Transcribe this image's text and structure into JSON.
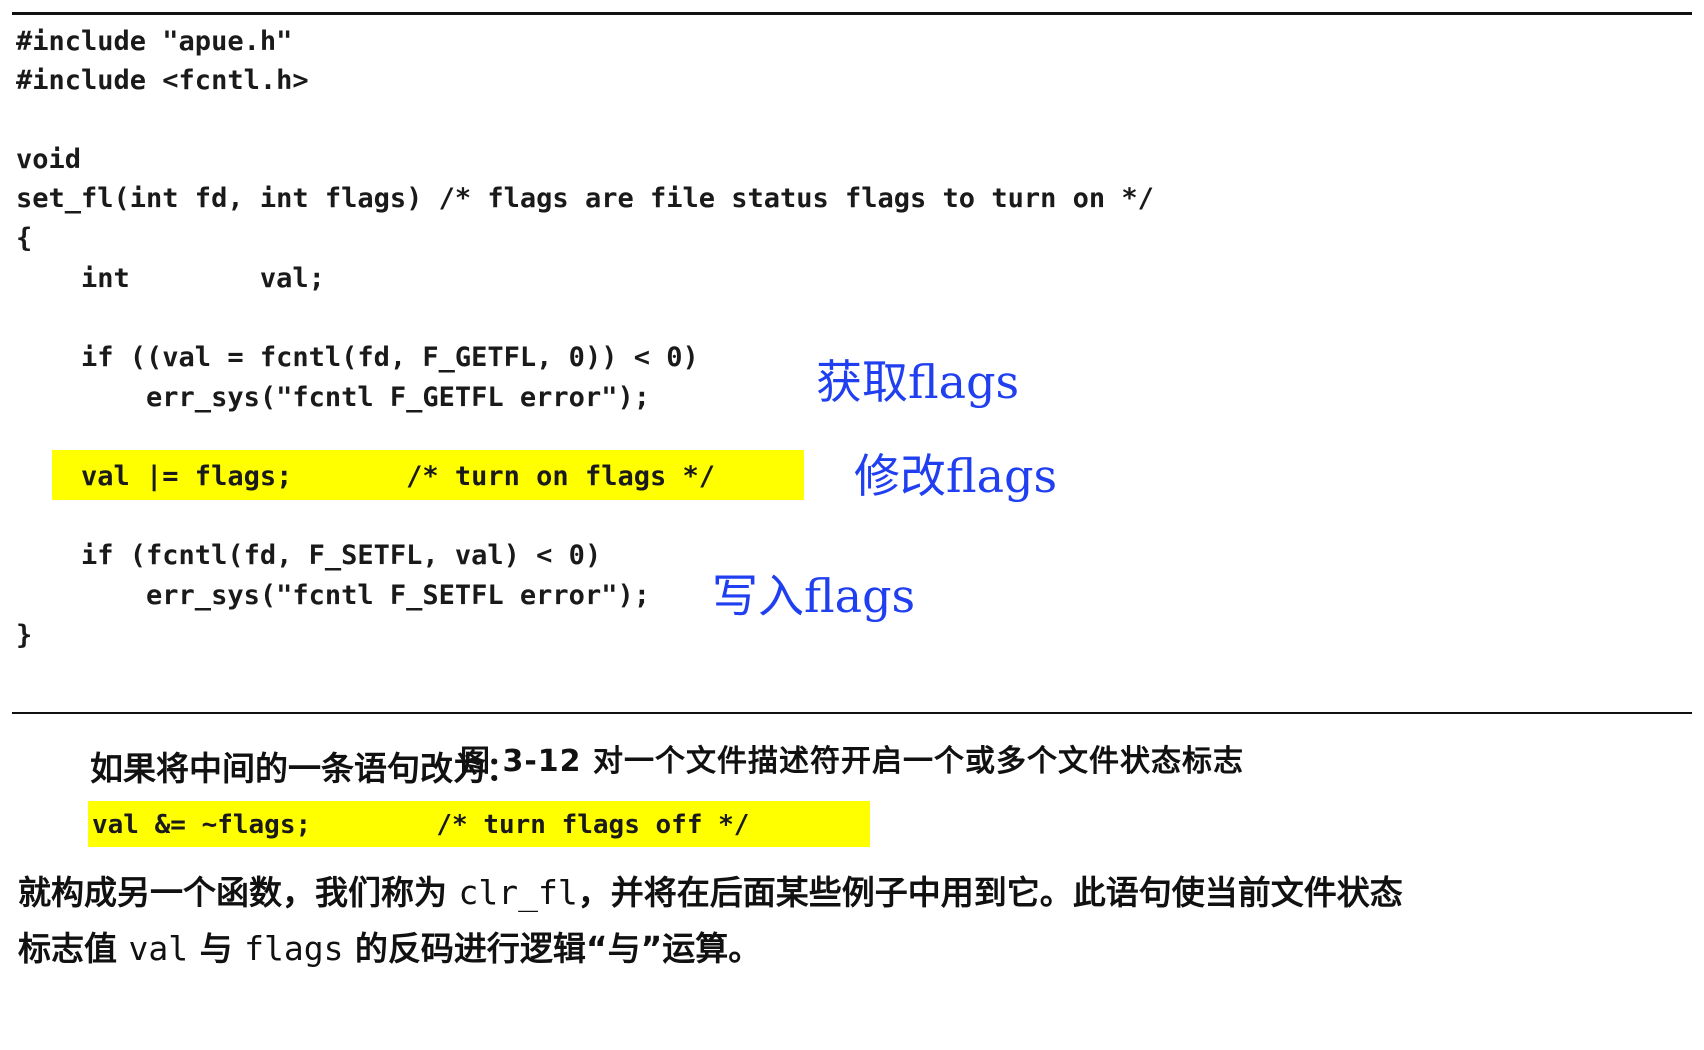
{
  "code": {
    "lines": [
      "#include \"apue.h\"",
      "#include <fcntl.h>",
      "",
      "void",
      "set_fl(int fd, int flags) /* flags are file status flags to turn on */",
      "{",
      "    int        val;",
      "",
      "    if ((val = fcntl(fd, F_GETFL, 0)) < 0)",
      "        err_sys(\"fcntl F_GETFL error\");",
      "",
      "    val |= flags;       /* turn on flags */",
      "",
      "    if (fcntl(fd, F_SETFL, val) < 0)",
      "        err_sys(\"fcntl F_SETFL error\");",
      "}"
    ]
  },
  "annotations": {
    "get_flags": "获取flags",
    "modify_flags": "修改flags",
    "write_flags": "写入flags"
  },
  "caption": "图 3-12   对一个文件描述符开启一个或多个文件状态标志",
  "paragraph": {
    "intro": "如果将中间的一条语句改为：",
    "alt_statement": "val &= ~flags;        /* turn flags off */",
    "body_line1_a": "就构成另一个函数，我们称为 ",
    "body_line1_code": "clr_fl",
    "body_line1_b": "，并将在后面某些例子中用到它。此语句使当前文件状态",
    "body_line2_a": "标志值 ",
    "body_line2_code1": "val",
    "body_line2_b": " 与 ",
    "body_line2_code2": "flags",
    "body_line2_c": " 的反码进行逻辑“与”运算。"
  },
  "colors": {
    "highlight": "#ffff00",
    "annotation": "#1f3ff0",
    "text": "#111111"
  }
}
